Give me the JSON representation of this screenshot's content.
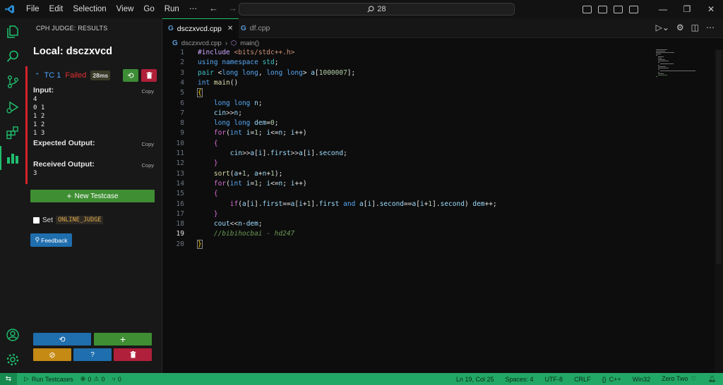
{
  "menu": [
    "File",
    "Edit",
    "Selection",
    "View",
    "Go",
    "Run",
    "⋯"
  ],
  "command_center": {
    "text": "28"
  },
  "activity_bar": {
    "items": [
      "explorer-icon",
      "search-icon",
      "source-control-icon",
      "run-debug-icon",
      "extensions-icon",
      "cph-icon"
    ],
    "bottom": [
      "account-icon",
      "gear-icon"
    ]
  },
  "sidebar": {
    "title": "CPH JUDGE: RESULTS",
    "local_title": "Local: dsczxvcd",
    "testcase": {
      "name": "TC 1",
      "status": "Failed",
      "time": "28ms",
      "input_label": "Input:",
      "input": "4\n0 1\n1 2\n1 2\n1 3",
      "expected_label": "Expected Output:",
      "expected": "",
      "received_label": "Received Output:",
      "received": "3",
      "copy": "Copy"
    },
    "new_testcase": "New Testcase",
    "set_label": "Set",
    "online_judge": "ONLINE_JUDGE",
    "feedback": "Feedback"
  },
  "editor": {
    "tabs": [
      {
        "label": "dsczxvcd.cpp",
        "active": true
      },
      {
        "label": "df.cpp",
        "active": false
      }
    ],
    "breadcrumb": [
      "dsczxvcd.cpp",
      "main()"
    ],
    "current_line": 19,
    "lines": [
      "#include <bits/stdc++.h>",
      "using namespace std;",
      "pair <long long, long long> a[1000007];",
      "int main()",
      "{",
      "    long long n;",
      "    cin>>n;",
      "    long long dem=0;",
      "    for(int i=1; i<=n; i++)",
      "    {",
      "        cin>>a[i].first>>a[i].second;",
      "    }",
      "    sort(a+1, a+n+1);",
      "    for(int i=1; i<=n; i++)",
      "    {",
      "        if(a[i].first==a[i+1].first and a[i].second==a[i+1].second) dem++;",
      "    }",
      "    cout<<n-dem;",
      "    //bibihocbai - hd247",
      "}"
    ]
  },
  "statusbar": {
    "run_testcases": "Run Testcases",
    "errors": "0",
    "warnings": "0",
    "ports": "0",
    "position": "Ln 19, Col 25",
    "spaces": "Spaces: 4",
    "encoding": "UTF-8",
    "eol": "CRLF",
    "language": "C++",
    "platform": "Win32",
    "theme": "Zero Two"
  },
  "colors": {
    "accent": "#22a866",
    "failed": "#d4232b",
    "tc_blue": "#4aa3ff"
  }
}
